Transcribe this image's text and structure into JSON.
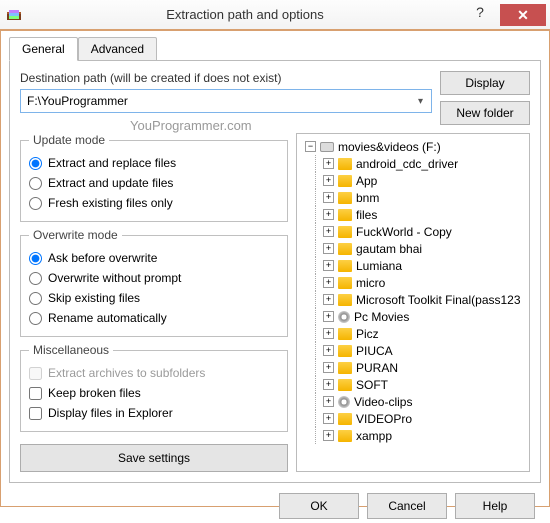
{
  "title": "Extraction path and options",
  "tabs": {
    "general": "General",
    "advanced": "Advanced"
  },
  "destination": {
    "label": "Destination path (will be created if does not exist)",
    "value": "F:\\YouProgrammer"
  },
  "buttons": {
    "display": "Display",
    "new_folder": "New folder",
    "save": "Save settings",
    "ok": "OK",
    "cancel": "Cancel",
    "help": "Help"
  },
  "watermark": "YouProgrammer.com",
  "groups": {
    "update": {
      "legend": "Update mode",
      "o1": "Extract and replace files",
      "o2": "Extract and update files",
      "o3": "Fresh existing files only"
    },
    "overwrite": {
      "legend": "Overwrite mode",
      "o1": "Ask before overwrite",
      "o2": "Overwrite without prompt",
      "o3": "Skip existing files",
      "o4": "Rename automatically"
    },
    "misc": {
      "legend": "Miscellaneous",
      "o1": "Extract archives to subfolders",
      "o2": "Keep broken files",
      "o3": "Display files in Explorer"
    }
  },
  "tree": {
    "root": "movies&videos (F:)",
    "items": [
      "android_cdc_driver",
      "App",
      "bnm",
      "files",
      "FuckWorld - Copy",
      "gautam bhai",
      "Lumiana",
      "micro",
      "Microsoft Toolkit Final(pass123",
      "Pc Movies",
      "Picz",
      "PIUCA",
      "PURAN",
      "SOFT",
      "Video-clips",
      "VIDEOPro",
      "xampp"
    ],
    "media_indices": [
      9,
      14
    ]
  }
}
